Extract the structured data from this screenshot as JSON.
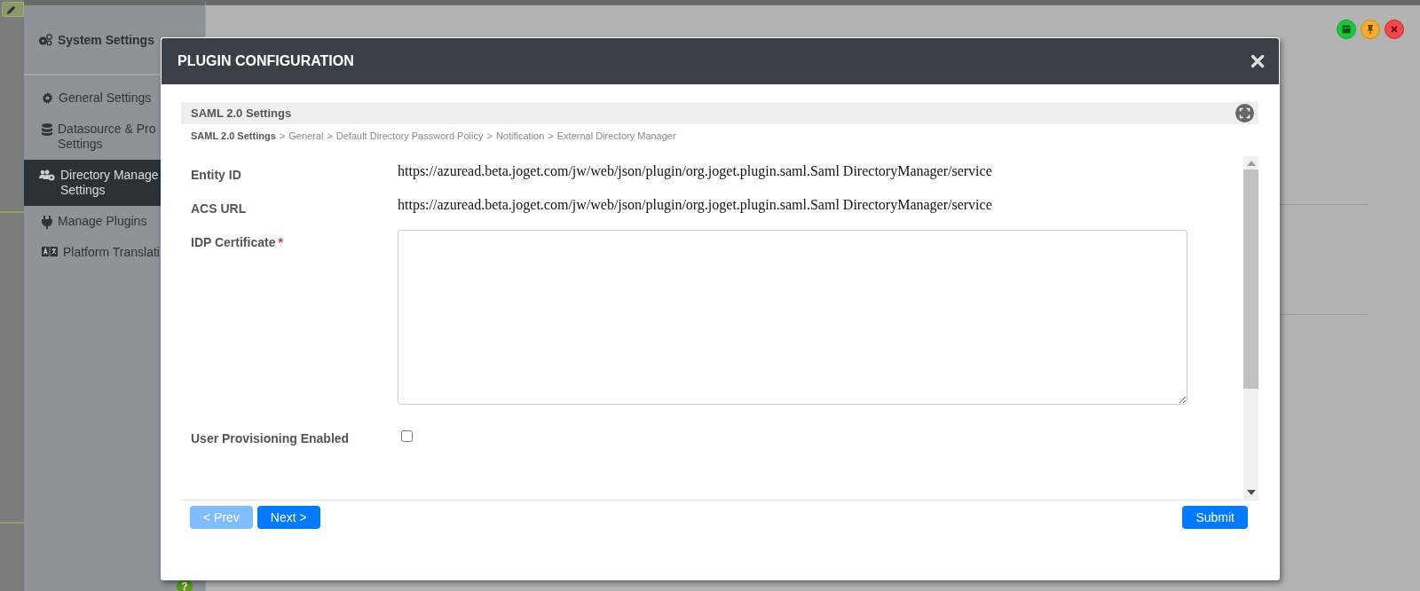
{
  "help_badge": "?",
  "sidebar": {
    "title": "System Settings",
    "items": [
      {
        "label": "General Settings",
        "selected": false
      },
      {
        "label": "Datasource & Pro Settings",
        "selected": false
      },
      {
        "label": "Directory Manage Settings",
        "selected": true
      },
      {
        "label": "Manage Plugins",
        "selected": false
      },
      {
        "label": "Platform Translati",
        "selected": false
      }
    ]
  },
  "dialog": {
    "title": "PLUGIN CONFIGURATION",
    "section_title": "SAML 2.0 Settings",
    "breadcrumb": [
      {
        "label": "SAML 2.0 Settings",
        "selected": true
      },
      {
        "separator": ">",
        "label": "General",
        "selected": false
      },
      {
        "separator": ">",
        "label": "Default Directory Password Policy",
        "selected": false
      },
      {
        "separator": ">",
        "label": "Notification",
        "selected": false
      },
      {
        "separator": ">",
        "label": "External Directory Manager",
        "selected": false
      }
    ],
    "fields": [
      {
        "kind": "text",
        "label": "Entity ID",
        "value": "https://azuread.beta.joget.com/jw/web/json/plugin/org.joget.plugin.saml.Saml DirectoryManager/service"
      },
      {
        "kind": "text",
        "label": "ACS URL",
        "value": "https://azuread.beta.joget.com/jw/web/json/plugin/org.joget.plugin.saml.Saml DirectoryManager/service"
      },
      {
        "kind": "textarea",
        "label": "IDP Certificate",
        "required_mark": "*"
      },
      {
        "kind": "checkbox",
        "label": "User Provisioning Enabled",
        "checked": false
      }
    ],
    "nav_buttons": [
      {
        "label": "< Prev",
        "disabled": true
      },
      {
        "label": "Next >",
        "disabled": false
      }
    ],
    "submit": "Submit"
  }
}
